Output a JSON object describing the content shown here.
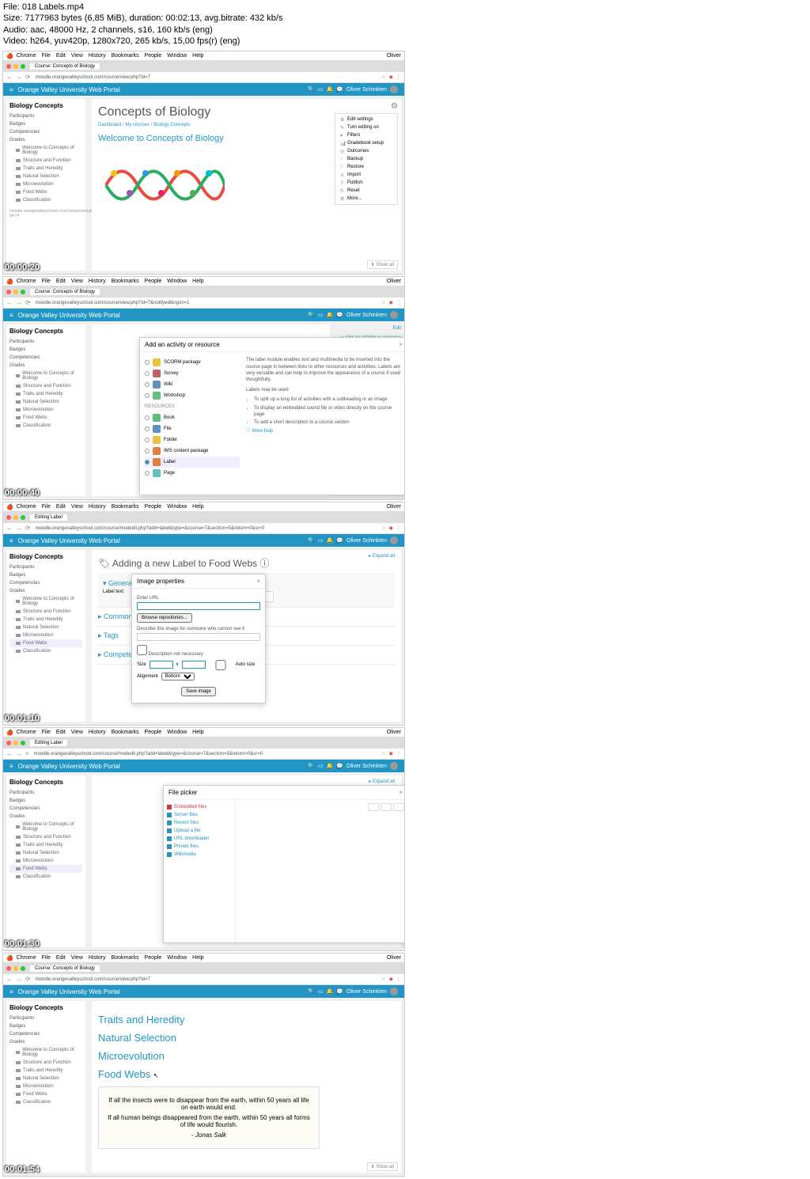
{
  "file_meta": {
    "file_label": "File:",
    "file_name": "018 Labels.mp4",
    "size_label": "Size:",
    "size_value": "7177963 bytes (6,85 MiB), duration: 00:02:13, avg.bitrate: 432 kb/s",
    "audio_label": "Audio:",
    "audio_value": "aac, 48000 Hz, 2 channels, s16, 160 kb/s (eng)",
    "video_label": "Video:",
    "video_value": "h264, yuv420p, 1280x720, 265 kb/s, 15,00 fps(r) (eng)"
  },
  "mac_menu": {
    "app": "Chrome",
    "items": [
      "File",
      "Edit",
      "View",
      "History",
      "Bookmarks",
      "People",
      "Window",
      "Help"
    ],
    "user": "Oliver"
  },
  "browser": {
    "tab_course": "Course: Concepts of Biology",
    "tab_editing": "Editing Label",
    "url_course": "moodle.orangevalleyschool.com/course/view.php?id=7",
    "url_course_edit": "moodle.orangevalleyschool.com/course/view.php?id=7&notifyeditingon=1",
    "url_modedit": "moodle.orangevalleyschool.com/course/modedit.php?add=label&type=&course=7&section=5&return=0&sr=0"
  },
  "portal": {
    "title": "Orange Valley University Web Portal",
    "user": "Oliver Schinkten"
  },
  "sidebar": {
    "heading": "Biology Concepts",
    "items": [
      "Participants",
      "Badges",
      "Competencies",
      "Grades"
    ],
    "subs": [
      "Welcome to Concepts of Biology",
      "Structure and Function",
      "Traits and Heredity",
      "Natural Selection",
      "Microevolution",
      "Food Webs",
      "Classification"
    ]
  },
  "statusbar_url": "moodle.orangevalleyschool.com/course/view.php?id=74",
  "frame1": {
    "timecode": "00:00:20",
    "title": "Concepts of Biology",
    "breadcrumb": [
      "Dashboard",
      "My courses",
      "Biology Concepts"
    ],
    "welcome": "Welcome to Concepts of Biology",
    "gear_items": [
      "Edit settings",
      "Turn editing on",
      "Filters",
      "Gradebook setup",
      "Outcomes",
      "Backup",
      "Restore",
      "Import",
      "Publish",
      "Reset",
      "More..."
    ],
    "show": "Show all"
  },
  "frame2": {
    "timecode": "00:00:40",
    "modal_title": "Add an activity or resource",
    "activities": [
      {
        "name": "SCORM package",
        "color": "#f0c040"
      },
      {
        "name": "Survey",
        "color": "#c06060"
      },
      {
        "name": "Wiki",
        "color": "#6090c0"
      },
      {
        "name": "Workshop",
        "color": "#60c080"
      }
    ],
    "resources_label": "RESOURCES",
    "resources": [
      {
        "name": "Book",
        "color": "#60c080"
      },
      {
        "name": "File",
        "color": "#6090c0"
      },
      {
        "name": "Folder",
        "color": "#f0c040"
      },
      {
        "name": "IMS content package",
        "color": "#e08040"
      },
      {
        "name": "Label",
        "color": "#e08040"
      },
      {
        "name": "Page",
        "color": "#60c0c0"
      }
    ],
    "description": "The label module enables text and multimedia to be inserted into the course page in between links to other resources and activities. Labels are very versatile and can help to improve the appearance of a course if used thoughtfully.",
    "uses_label": "Labels may be used",
    "uses": [
      "To split up a long list of activities with a subheading or an image",
      "To display an embedded sound file or video directly on the course page",
      "To add a short description to a course section"
    ],
    "more_help": "More help",
    "edit": "Edit",
    "add_activity": "Add an activity or resource"
  },
  "frame3": {
    "timecode": "00:01:10",
    "title": "Adding a new Label to Food Webs",
    "general": "General",
    "label_text": "Label text",
    "sections": [
      "Common module settings",
      "Tags",
      "Competencies"
    ],
    "modal_title": "Image properties",
    "enter_url": "Enter URL",
    "browse": "Browse repositories...",
    "describe": "Describe this image for someone who cannot see it",
    "not_necessary": "Description not necessary",
    "size": "Size",
    "auto_size": "Auto size",
    "alignment": "Alignment",
    "alignment_val": "Bottom",
    "save": "Save image",
    "expand_all": "Expand all"
  },
  "frame4": {
    "timecode": "00:01:30",
    "modal_title": "File picker",
    "repos": [
      {
        "name": "Embedded files",
        "color": "#d33"
      },
      {
        "name": "Server files",
        "color": "#2196c4"
      },
      {
        "name": "Recent files",
        "color": "#2196c4"
      },
      {
        "name": "Upload a file",
        "color": "#2196c4"
      },
      {
        "name": "URL downloader",
        "color": "#2196c4"
      },
      {
        "name": "Private files",
        "color": "#2196c4"
      },
      {
        "name": "Wikimedia",
        "color": "#2196c4"
      }
    ],
    "expand_all": "Expand all"
  },
  "frame5": {
    "timecode": "00:01:54",
    "sections": [
      "Traits and Heredity",
      "Natural Selection",
      "Microevolution",
      "Food Webs"
    ],
    "quote1": "If all the insects were to disappear from the earth, within 50 years all life on earth would end.",
    "quote2": "If all human beings disappeared from the earth, within 50 years all forms of life would flourish.",
    "author": "- Jonas Salk",
    "show": "Show all"
  }
}
